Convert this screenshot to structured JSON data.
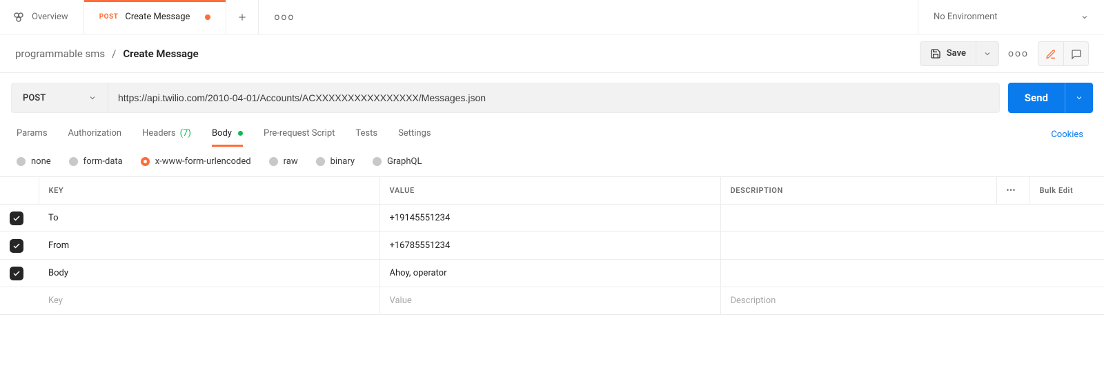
{
  "tabs": {
    "overview_label": "Overview",
    "active_method": "POST",
    "active_label": "Create Message"
  },
  "env": {
    "label": "No Environment"
  },
  "breadcrumb": {
    "collection": "programmable sms",
    "separator": "/",
    "current": "Create Message"
  },
  "actions": {
    "save_label": "Save"
  },
  "request": {
    "method": "POST",
    "url": "https://api.twilio.com/2010-04-01/Accounts/ACXXXXXXXXXXXXXXXX/Messages.json",
    "send_label": "Send"
  },
  "req_tabs": {
    "params": "Params",
    "authorization": "Authorization",
    "headers": "Headers",
    "headers_count": "(7)",
    "body": "Body",
    "prerequest": "Pre-request Script",
    "tests": "Tests",
    "settings": "Settings",
    "cookies": "Cookies"
  },
  "body_types": {
    "none": "none",
    "formdata": "form-data",
    "urlencoded": "x-www-form-urlencoded",
    "raw": "raw",
    "binary": "binary",
    "graphql": "GraphQL"
  },
  "kv_headers": {
    "more": "•••",
    "bulk": "Bulk Edit"
  },
  "kv_rows": [
    {
      "enabled": true,
      "key": "To",
      "value": "+19145551234",
      "desc": ""
    },
    {
      "enabled": true,
      "key": "From",
      "value": "+16785551234",
      "desc": ""
    },
    {
      "enabled": true,
      "key": "Body",
      "value": "Ahoy, operator",
      "desc": ""
    }
  ],
  "kv_placeholder": {
    "key": "Key",
    "value": "Value",
    "desc": "Description"
  }
}
